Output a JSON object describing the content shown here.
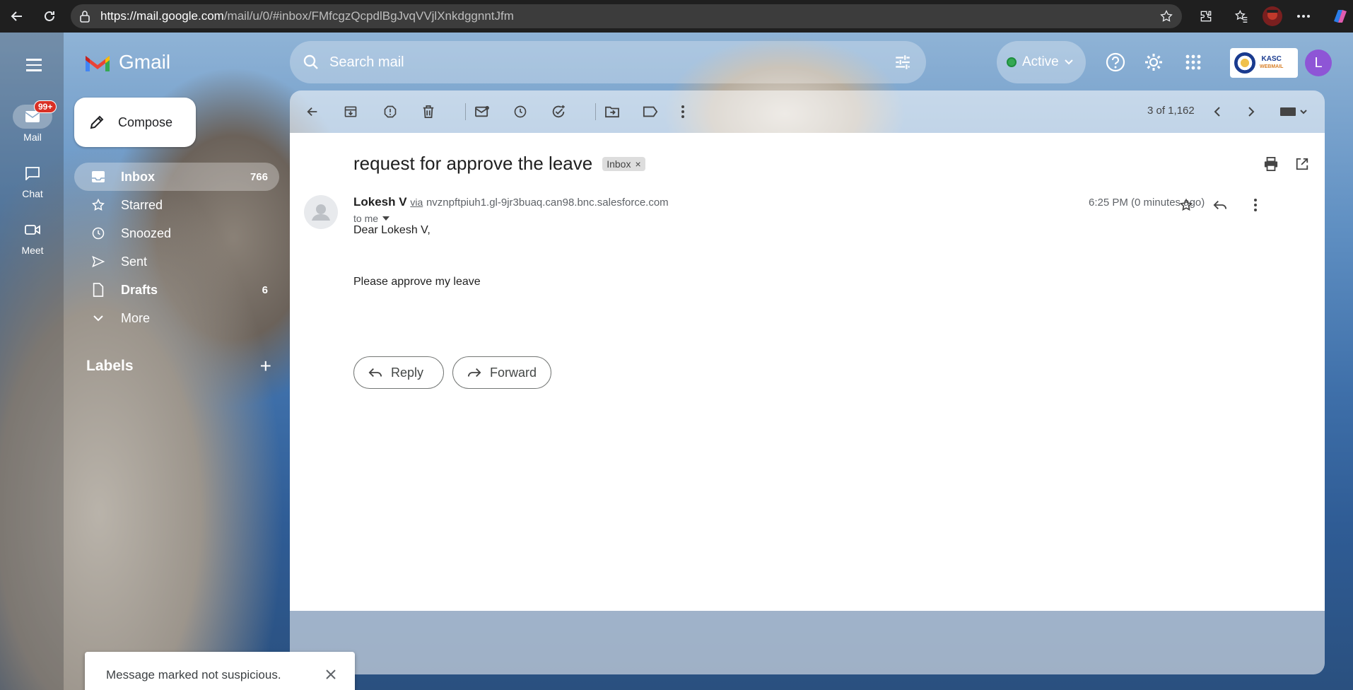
{
  "browser": {
    "url_host": "https://mail.google.com",
    "url_rest": "/mail/u/0/#inbox/FMfcgzQcpdlBgJvqVVjlXnkdggnntJfm"
  },
  "app": {
    "name": "Gmail"
  },
  "rail": {
    "mail_label": "Mail",
    "mail_badge": "99+",
    "chat_label": "Chat",
    "meet_label": "Meet"
  },
  "compose": {
    "label": "Compose"
  },
  "nav": {
    "items": [
      {
        "label": "Inbox",
        "count": "766"
      },
      {
        "label": "Starred",
        "count": ""
      },
      {
        "label": "Snoozed",
        "count": ""
      },
      {
        "label": "Sent",
        "count": ""
      },
      {
        "label": "Drafts",
        "count": "6"
      },
      {
        "label": "More",
        "count": ""
      }
    ]
  },
  "labels": {
    "title": "Labels",
    "add": "+"
  },
  "search": {
    "placeholder": "Search mail"
  },
  "status": {
    "label": "Active",
    "color": "#34a853"
  },
  "toolbar": {
    "count": "3 of 1,162"
  },
  "message": {
    "subject": "request for approve the leave",
    "chip": "Inbox",
    "sender_name": "Lokesh V",
    "via": "via",
    "sender_email": "nvznpftpiuh1.gl-9jr3buaq.can98.bnc.salesforce.com",
    "to": "to me",
    "time": "6:25 PM (0 minutes ago)",
    "greeting": "Dear Lokesh V,",
    "body": "Please approve my leave"
  },
  "actions": {
    "reply": "Reply",
    "forward": "Forward"
  },
  "toast": {
    "text": "Message marked not suspicious."
  },
  "org_logo": {
    "line1": "KASC",
    "line2": "WEBMAIL"
  },
  "avatar": {
    "initial": "L",
    "color": "#8e55d6"
  }
}
